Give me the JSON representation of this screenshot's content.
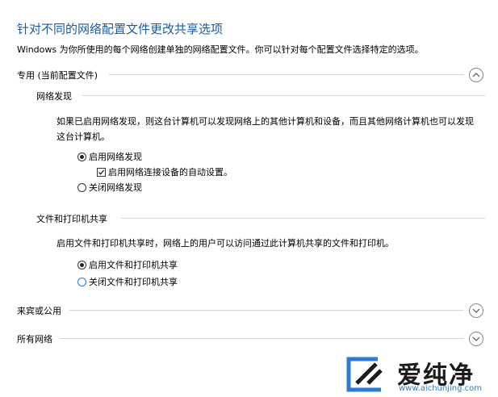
{
  "page": {
    "title": "针对不同的网络配置文件更改共享选项",
    "description": "Windows 为你所使用的每个网络创建单独的网络配置文件。你可以针对每个配置文件选择特定的选项。"
  },
  "sections": {
    "private": {
      "label": "专用 (当前配置文件)",
      "expanded": true
    },
    "guest": {
      "label": "来宾或公用",
      "expanded": false
    },
    "all": {
      "label": "所有网络",
      "expanded": false
    }
  },
  "network_discovery": {
    "heading": "网络发现",
    "description": "如果已启用网络发现，则这台计算机可以发现网络上的其他计算机和设备，而且其他网络计算机也可以发现这台计算机。",
    "option_on": "启用网络发现",
    "option_auto": "启用网络连接设备的自动设置。",
    "option_off": "关闭网络发现",
    "selected": "on",
    "auto_checked": true
  },
  "file_sharing": {
    "heading": "文件和打印机共享",
    "description": "启用文件和打印机共享时，网络上的用户可以访问通过此计算机共享的文件和打印机。",
    "option_on": "启用文件和打印机共享",
    "option_off": "关闭文件和打印机共享",
    "selected": "on"
  },
  "watermark": {
    "brand": "爱纯净",
    "url": "www.aichunjing.com"
  },
  "colors": {
    "title": "#1c5b9e",
    "accent": "#2a7bd4",
    "divider": "#d5d5d5"
  }
}
